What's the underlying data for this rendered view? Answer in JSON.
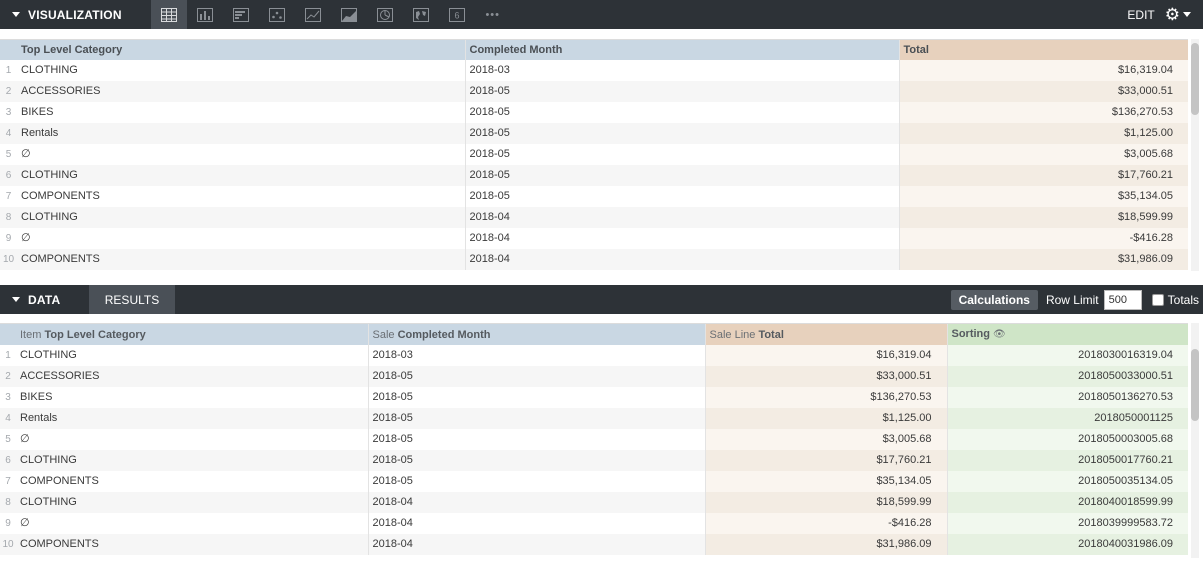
{
  "visualization": {
    "title": "VISUALIZATION",
    "edit_label": "EDIT",
    "tools": [
      {
        "name": "table-icon",
        "active": true
      },
      {
        "name": "column-chart-icon"
      },
      {
        "name": "bar-chart-icon"
      },
      {
        "name": "scatter-chart-icon"
      },
      {
        "name": "line-chart-icon"
      },
      {
        "name": "area-chart-icon"
      },
      {
        "name": "pie-chart-icon"
      },
      {
        "name": "map-icon"
      },
      {
        "name": "single-value-icon",
        "label": "6"
      },
      {
        "name": "more-icon",
        "label": "•••"
      }
    ],
    "table": {
      "headers": [
        "Top Level Category",
        "Completed Month",
        "Total"
      ],
      "rows": [
        {
          "n": "1",
          "category": "CLOTHING",
          "month": "2018-03",
          "total": "$16,319.04"
        },
        {
          "n": "2",
          "category": "ACCESSORIES",
          "month": "2018-05",
          "total": "$33,000.51"
        },
        {
          "n": "3",
          "category": "BIKES",
          "month": "2018-05",
          "total": "$136,270.53"
        },
        {
          "n": "4",
          "category": "Rentals",
          "month": "2018-05",
          "total": "$1,125.00"
        },
        {
          "n": "5",
          "category": "∅",
          "month": "2018-05",
          "total": "$3,005.68"
        },
        {
          "n": "6",
          "category": "CLOTHING",
          "month": "2018-05",
          "total": "$17,760.21"
        },
        {
          "n": "7",
          "category": "COMPONENTS",
          "month": "2018-05",
          "total": "$35,134.05"
        },
        {
          "n": "8",
          "category": "CLOTHING",
          "month": "2018-04",
          "total": "$18,599.99"
        },
        {
          "n": "9",
          "category": "∅",
          "month": "2018-04",
          "total": "-$416.28"
        },
        {
          "n": "10",
          "category": "COMPONENTS",
          "month": "2018-04",
          "total": "$31,986.09"
        }
      ]
    }
  },
  "data": {
    "title": "DATA",
    "results_tab": "RESULTS",
    "calculations_label": "Calculations",
    "row_limit_label": "Row Limit",
    "row_limit_value": "500",
    "totals_label": "Totals",
    "table": {
      "headers": [
        {
          "prefix": "Item ",
          "main": "Top Level Category"
        },
        {
          "prefix": "Sale ",
          "main": "Completed Month"
        },
        {
          "prefix": "Sale Line ",
          "main": "Total"
        },
        {
          "prefix": "",
          "main": "Sorting"
        }
      ],
      "rows": [
        {
          "n": "1",
          "category": "CLOTHING",
          "month": "2018-03",
          "total": "$16,319.04",
          "sorting": "2018030016319.04"
        },
        {
          "n": "2",
          "category": "ACCESSORIES",
          "month": "2018-05",
          "total": "$33,000.51",
          "sorting": "2018050033000.51"
        },
        {
          "n": "3",
          "category": "BIKES",
          "month": "2018-05",
          "total": "$136,270.53",
          "sorting": "2018050136270.53"
        },
        {
          "n": "4",
          "category": "Rentals",
          "month": "2018-05",
          "total": "$1,125.00",
          "sorting": "2018050001125"
        },
        {
          "n": "5",
          "category": "∅",
          "month": "2018-05",
          "total": "$3,005.68",
          "sorting": "2018050003005.68"
        },
        {
          "n": "6",
          "category": "CLOTHING",
          "month": "2018-05",
          "total": "$17,760.21",
          "sorting": "2018050017760.21"
        },
        {
          "n": "7",
          "category": "COMPONENTS",
          "month": "2018-05",
          "total": "$35,134.05",
          "sorting": "2018050035134.05"
        },
        {
          "n": "8",
          "category": "CLOTHING",
          "month": "2018-04",
          "total": "$18,599.99",
          "sorting": "2018040018599.99"
        },
        {
          "n": "9",
          "category": "∅",
          "month": "2018-04",
          "total": "-$416.28",
          "sorting": "2018039999583.72"
        },
        {
          "n": "10",
          "category": "COMPONENTS",
          "month": "2018-04",
          "total": "$31,986.09",
          "sorting": "2018040031986.09"
        }
      ]
    }
  },
  "colors": {
    "header_bar": "#2d3237",
    "dimension_header": "#c9d7e3",
    "measure_header": "#e7d1bd",
    "calculation_header": "#cfe5c7"
  }
}
